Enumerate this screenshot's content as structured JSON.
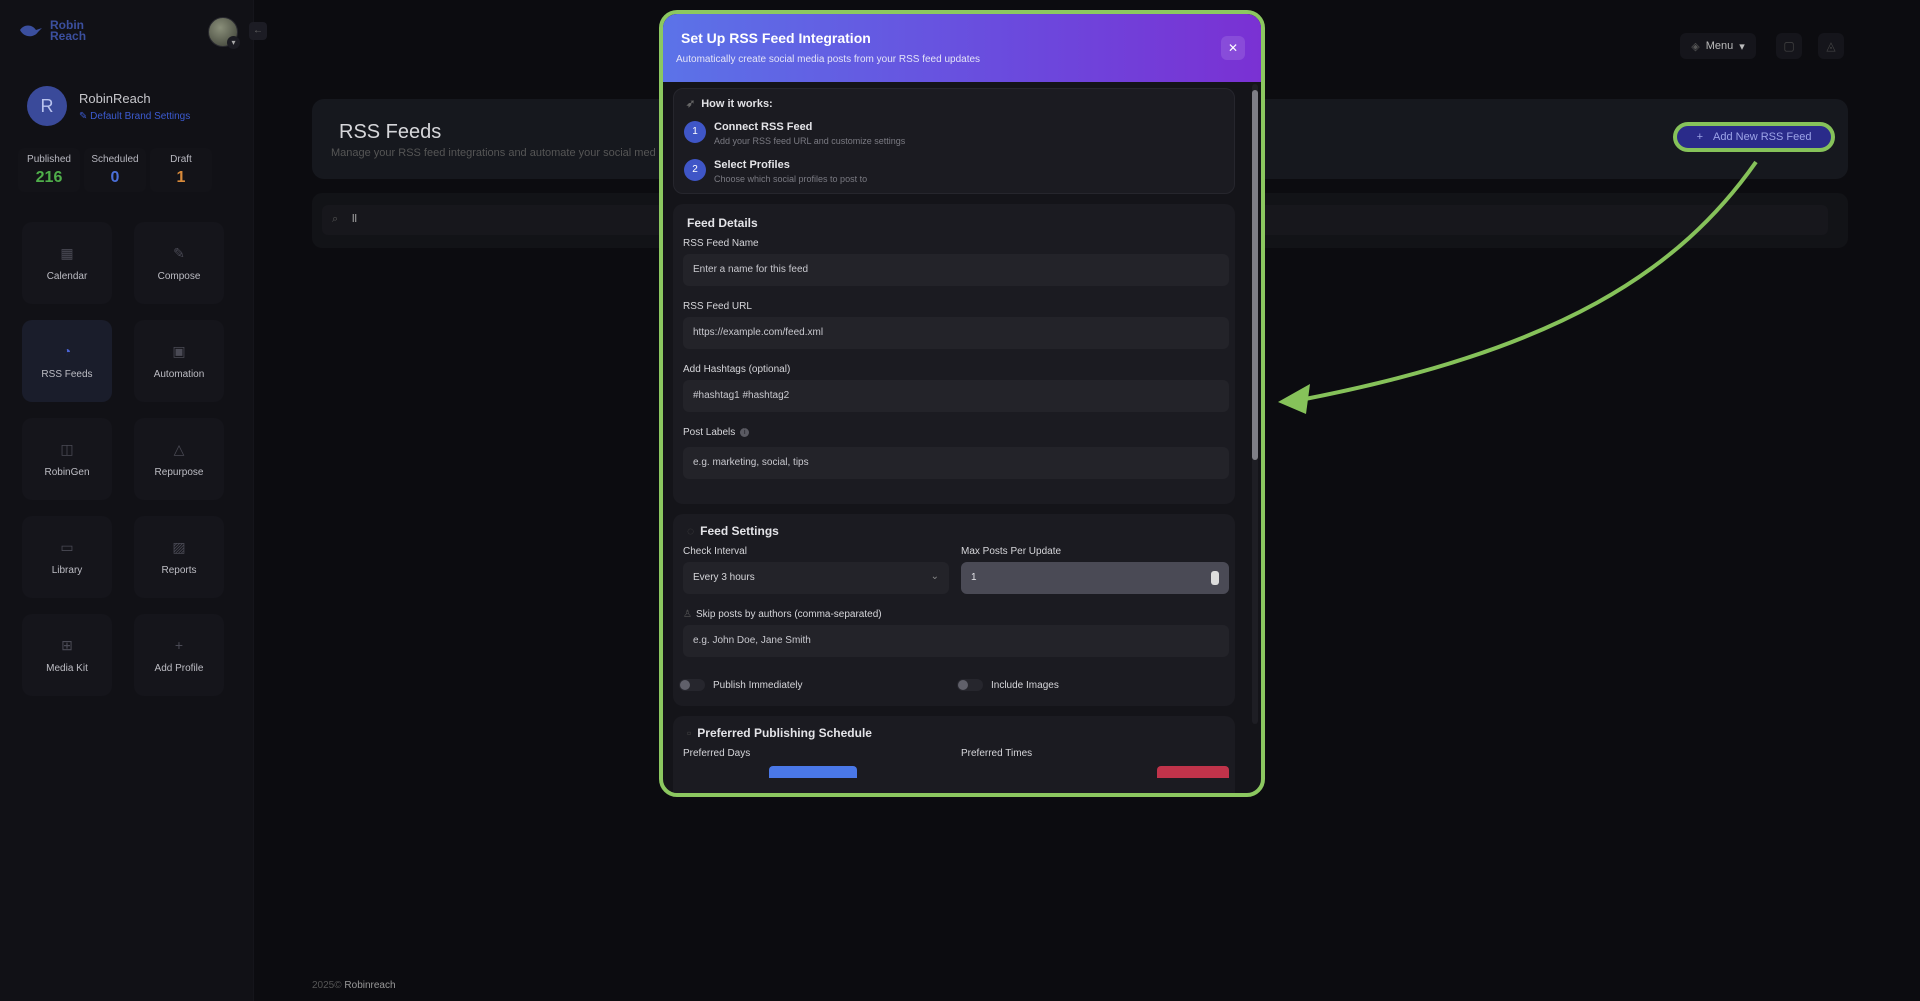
{
  "app": {
    "logo_text_1": "Robin",
    "logo_text_2": "Reach",
    "brand_color": "#3b4f9e",
    "accent_color": "#86c25a"
  },
  "sidebar": {
    "profile": {
      "initial": "R",
      "name": "RobinReach",
      "link": "Default Brand Settings"
    },
    "stats": [
      {
        "label": "Published",
        "value": "216",
        "color": "#4fae4a"
      },
      {
        "label": "Scheduled",
        "value": "0",
        "color": "#4a6fd8"
      },
      {
        "label": "Draft",
        "value": "1",
        "color": "#d88a3a"
      }
    ],
    "tiles": [
      {
        "label": "Calendar",
        "icon": "calendar-icon",
        "glyph": "▦"
      },
      {
        "label": "Compose",
        "icon": "tag-icon",
        "glyph": "✎"
      },
      {
        "label": "RSS Feeds",
        "icon": "rss-icon",
        "glyph": "◔"
      },
      {
        "label": "Automation",
        "icon": "automation-icon",
        "glyph": "▣"
      },
      {
        "label": "RobinGen",
        "icon": "robingen-icon",
        "glyph": "◫"
      },
      {
        "label": "Repurpose",
        "icon": "recycle-icon",
        "glyph": "△"
      },
      {
        "label": "Library",
        "icon": "folder-icon",
        "glyph": "▭"
      },
      {
        "label": "Reports",
        "icon": "chart-icon",
        "glyph": "▨"
      },
      {
        "label": "Media Kit",
        "icon": "grid-icon",
        "glyph": "⊞"
      },
      {
        "label": "Add Profile",
        "icon": "plus-icon",
        "glyph": "+"
      }
    ]
  },
  "header": {
    "menu_label": "Menu"
  },
  "page": {
    "title": "RSS Feeds",
    "subtitle": "Manage your RSS feed integrations and automate your social med",
    "add_button": "Add New RSS Feed",
    "search_value": "ll",
    "footer_year": "2025©",
    "footer_brand": "Robinreach"
  },
  "modal": {
    "title": "Set Up RSS Feed Integration",
    "subtitle": "Automatically create social media posts from your RSS feed updates",
    "how_title": "How it works:",
    "steps": [
      {
        "num": "1",
        "title": "Connect RSS Feed",
        "desc": "Add your RSS feed URL and customize settings"
      },
      {
        "num": "2",
        "title": "Select Profiles",
        "desc": "Choose which social profiles to post to"
      }
    ],
    "details": {
      "title": "Feed Details",
      "name_label": "RSS Feed Name",
      "name_placeholder": "Enter a name for this feed",
      "url_label": "RSS Feed URL",
      "url_placeholder": "https://example.com/feed.xml",
      "hashtags_label": "Add Hashtags (optional)",
      "hashtags_placeholder": "#hashtag1 #hashtag2",
      "labels_label": "Post Labels",
      "labels_placeholder": "e.g. marketing, social, tips"
    },
    "settings": {
      "title": "Feed Settings",
      "interval_label": "Check Interval",
      "interval_value": "Every 3 hours",
      "max_label": "Max Posts Per Update",
      "max_value": "1",
      "skip_label": "Skip posts by authors (comma-separated)",
      "skip_placeholder": "e.g. John Doe, Jane Smith",
      "publish_label": "Publish Immediately",
      "images_label": "Include Images"
    },
    "schedule": {
      "title": "Preferred Publishing Schedule",
      "days_label": "Preferred Days",
      "times_label": "Preferred Times"
    }
  }
}
